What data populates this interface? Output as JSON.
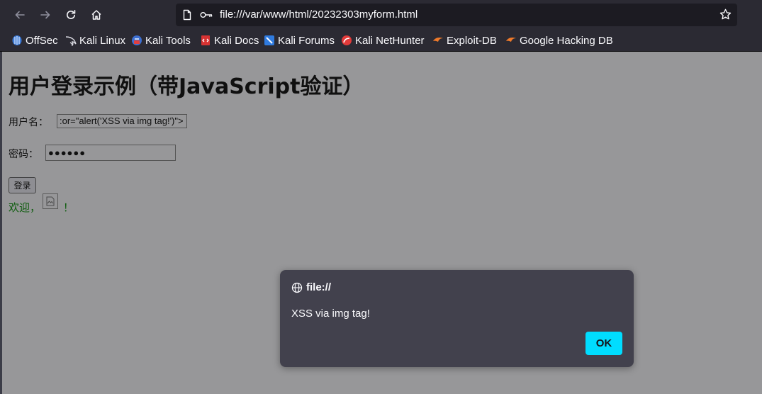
{
  "browser": {
    "url": "file:///var/www/html/20232303myform.html",
    "bookmarks": [
      {
        "label": "OffSec",
        "icon": "offsec-icon"
      },
      {
        "label": "Kali Linux",
        "icon": "kali-dragon-icon"
      },
      {
        "label": "Kali Tools",
        "icon": "kali-tools-icon"
      },
      {
        "label": "Kali Docs",
        "icon": "kali-docs-icon"
      },
      {
        "label": "Kali Forums",
        "icon": "kali-forums-icon"
      },
      {
        "label": "Kali NetHunter",
        "icon": "kali-nethunter-icon"
      },
      {
        "label": "Exploit-DB",
        "icon": "exploit-db-icon"
      },
      {
        "label": "Google Hacking DB",
        "icon": "exploit-db-icon"
      }
    ]
  },
  "page": {
    "title": "用户登录示例（带JavaScript验证）",
    "username_label": "用户名：",
    "username_value": ":or=\"alert('XSS via img tag!')\">",
    "password_label": "密码：",
    "password_value": "●●●●●●",
    "login_button": "登录",
    "welcome_text": "欢迎，",
    "welcome_suffix": "！"
  },
  "alert": {
    "origin": "file://",
    "message": "XSS via img tag!",
    "ok_label": "OK"
  },
  "colors": {
    "chrome_bg": "#2b2a33",
    "page_bg": "#979799",
    "dialog_bg": "#42414d",
    "ok_button": "#00ddff",
    "welcome_text": "#0f5d0f"
  }
}
